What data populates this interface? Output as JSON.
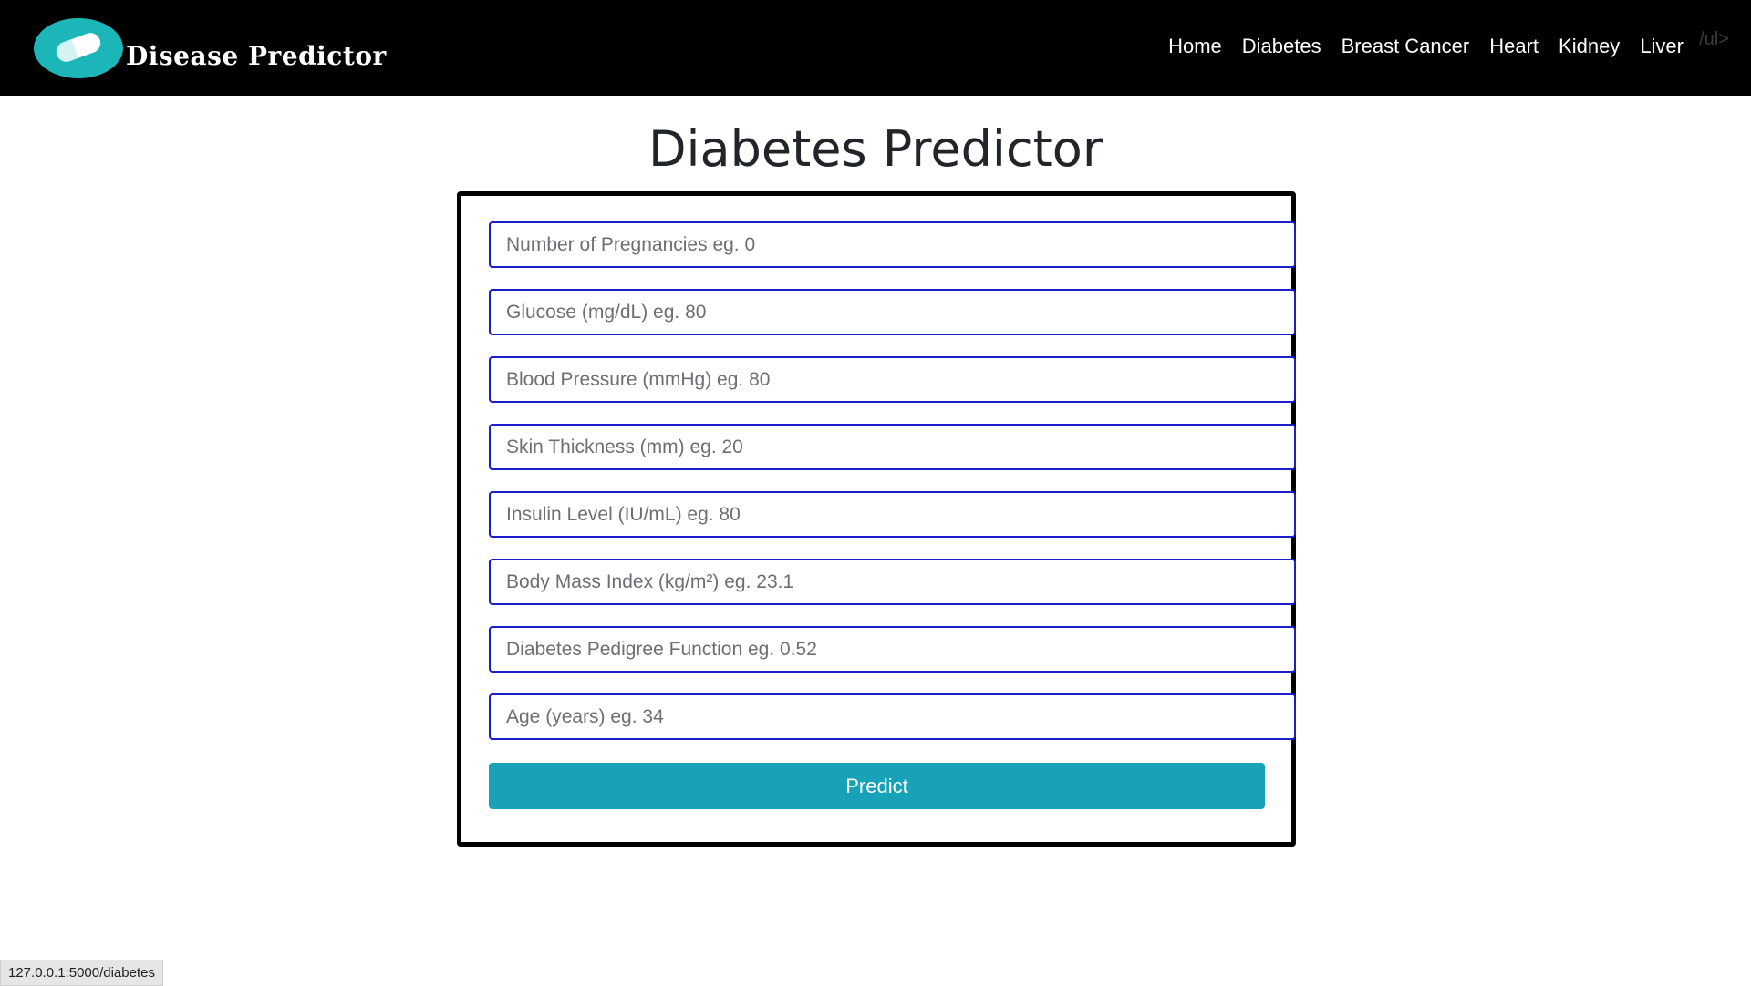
{
  "brand": {
    "name": "Disease Predictor",
    "logo_icon": "pill-capsule-icon",
    "logo_color": "#1cb5b8"
  },
  "nav": {
    "items": [
      {
        "label": "Home"
      },
      {
        "label": "Diabetes"
      },
      {
        "label": "Breast Cancer"
      },
      {
        "label": "Heart"
      },
      {
        "label": "Kidney"
      },
      {
        "label": "Liver"
      }
    ],
    "stray_text": "/ul>"
  },
  "page": {
    "title": "Diabetes Predictor"
  },
  "form": {
    "fields": [
      {
        "placeholder": "Number of Pregnancies eg. 0",
        "value": ""
      },
      {
        "placeholder": "Glucose (mg/dL) eg. 80",
        "value": ""
      },
      {
        "placeholder": "Blood Pressure (mmHg) eg. 80",
        "value": ""
      },
      {
        "placeholder": "Skin Thickness (mm) eg. 20",
        "value": ""
      },
      {
        "placeholder": "Insulin Level (IU/mL) eg. 80",
        "value": ""
      },
      {
        "placeholder": "Body Mass Index (kg/m²) eg. 23.1",
        "value": ""
      },
      {
        "placeholder": "Diabetes Pedigree Function eg. 0.52",
        "value": ""
      },
      {
        "placeholder": "Age (years) eg. 34",
        "value": ""
      }
    ],
    "submit_label": "Predict",
    "field_border_color": "#1b1fc9",
    "button_color": "#17a2b8"
  },
  "status_bar": {
    "url": "127.0.0.1:5000/diabetes"
  }
}
